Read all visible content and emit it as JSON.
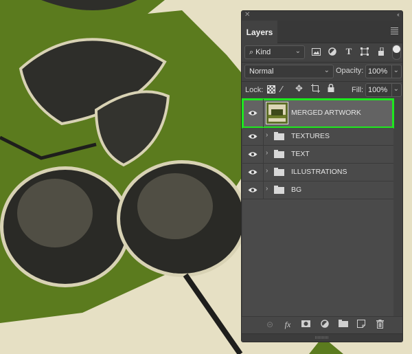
{
  "panel": {
    "close_icon": "close-icon",
    "collapse_icon": "collapse-double-chevron-icon",
    "tab_label": "Layers",
    "menu_icon": "panel-menu-icon",
    "filter": {
      "kind_value": "Kind",
      "kind_icon": "search-icon",
      "filter_icons": [
        "image-filter-icon",
        "adjustment-filter-icon",
        "type-filter-icon",
        "shape-filter-icon",
        "smart-object-filter-icon"
      ],
      "toggle_icon": "filter-toggle-switch"
    },
    "blend": {
      "mode": "Normal",
      "opacity_label": "Opacity:",
      "opacity_value": "100%"
    },
    "lock": {
      "label": "Lock:",
      "icons": [
        "lock-transparent-pixels-icon",
        "lock-image-pixels-icon",
        "lock-position-icon",
        "lock-artboard-icon",
        "lock-all-icon"
      ],
      "fill_label": "Fill:",
      "fill_value": "100%"
    },
    "layers": [
      {
        "name": "MERGED ARTWORK",
        "type": "smart-object",
        "visible": true,
        "selected": true
      },
      {
        "name": "TEXTURES",
        "type": "group",
        "visible": true,
        "selected": false
      },
      {
        "name": "TEXT",
        "type": "group",
        "visible": true,
        "selected": false
      },
      {
        "name": "ILLUSTRATIONS",
        "type": "group",
        "visible": true,
        "selected": false
      },
      {
        "name": "BG",
        "type": "group",
        "visible": true,
        "selected": false
      }
    ],
    "footer_icons": [
      "link-layers-icon",
      "fx-icon",
      "add-mask-icon",
      "new-adjustment-layer-icon",
      "new-group-icon",
      "new-layer-icon",
      "trash-icon"
    ]
  },
  "colors": {
    "highlight": "#1ee81e",
    "canvas_green": "#5a7a1e",
    "canvas_cream": "#e6e0c4",
    "panel_bg": "#424242"
  }
}
